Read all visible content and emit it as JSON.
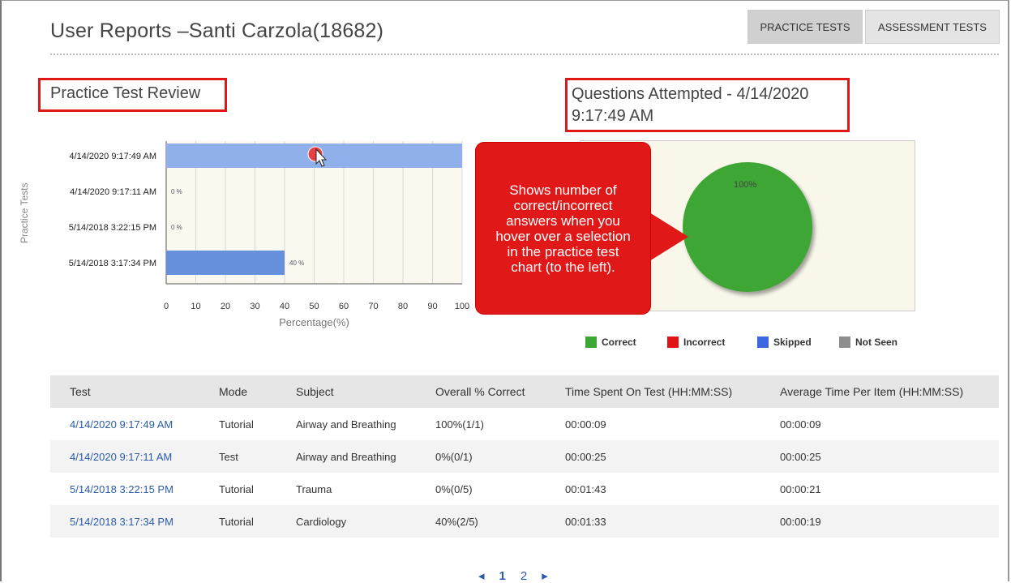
{
  "header": {
    "title": "User Reports –Santi Carzola(18682)",
    "tabs": [
      {
        "label": "PRACTICE TESTS",
        "active": true
      },
      {
        "label": "ASSESSMENT TESTS",
        "active": false
      }
    ]
  },
  "practice_review": {
    "title": "Practice Test Review",
    "y_axis_label": "Practice Tests"
  },
  "chart_data": [
    {
      "type": "bar",
      "orientation": "horizontal",
      "categories": [
        "4/14/2020 9:17:49 AM",
        "4/14/2020 9:17:11 AM",
        "5/14/2018 3:22:15 PM",
        "5/14/2018 3:17:34 PM"
      ],
      "values": [
        100,
        0,
        0,
        40
      ],
      "data_labels": [
        "",
        "0 %",
        "0 %",
        "40 %"
      ],
      "highlighted_index": 0,
      "xlabel": "Percentage(%)",
      "xlim": [
        0,
        100
      ],
      "xticks": [
        0,
        10,
        20,
        30,
        40,
        50,
        60,
        70,
        80,
        90,
        100
      ],
      "grid": true,
      "colors": {
        "bar": "#6490dc",
        "bar_highlight": "#8fb0ea"
      }
    },
    {
      "type": "pie",
      "title": "Questions Attempted - 4/14/2020 9:17:49 AM",
      "slices": [
        {
          "name": "Correct",
          "value": 100,
          "label": "100%",
          "color": "#3ea635"
        }
      ],
      "legend": [
        {
          "name": "Correct",
          "color": "#3ea635"
        },
        {
          "name": "Incorrect",
          "color": "#e01414"
        },
        {
          "name": "Skipped",
          "color": "#3b68e0"
        },
        {
          "name": "Not Seen",
          "color": "#8e8e8e"
        }
      ],
      "legend_placement": "bottom"
    }
  ],
  "callout": {
    "text": "Shows number of correct/incorrect answers when you hover over a selection in the practice test chart (to the left)."
  },
  "table": {
    "columns": [
      "Test",
      "Mode",
      "Subject",
      "Overall % Correct",
      "Time Spent On Test (HH:MM:SS)",
      "Average Time Per Item (HH:MM:SS)"
    ],
    "rows": [
      [
        "4/14/2020 9:17:49 AM",
        "Tutorial",
        "Airway and Breathing",
        "100%(1/1)",
        "00:00:09",
        "00:00:09"
      ],
      [
        "4/14/2020 9:17:11 AM",
        "Test",
        "Airway and Breathing",
        "0%(0/1)",
        "00:00:25",
        "00:00:25"
      ],
      [
        "5/14/2018 3:22:15 PM",
        "Tutorial",
        "Trauma",
        "0%(0/5)",
        "00:01:43",
        "00:00:21"
      ],
      [
        "5/14/2018 3:17:34 PM",
        "Tutorial",
        "Cardiology",
        "40%(2/5)",
        "00:01:33",
        "00:00:19"
      ]
    ]
  },
  "pagination": {
    "prev": "◂",
    "pages": [
      "1",
      "2"
    ],
    "current": "1",
    "next": "▸"
  }
}
